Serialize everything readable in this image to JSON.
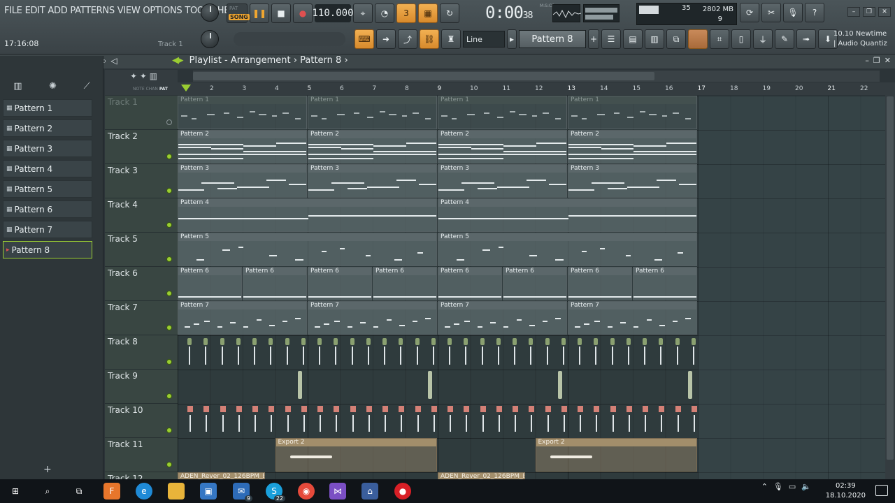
{
  "menu": [
    "FILE",
    "EDIT",
    "ADD",
    "PATTERNS",
    "VIEW",
    "OPTIONS",
    "TOOLS",
    "HELP"
  ],
  "hint": {
    "time": "17:16:08",
    "track": "Track 1"
  },
  "transport": {
    "pat": "PAT",
    "song": "SONG",
    "tempo": "110.000",
    "time": "0:00",
    "time_small": "38",
    "msc": "M:S:CS"
  },
  "cpu": {
    "v1": "35",
    "mem": "2802 MB",
    "poly": "9"
  },
  "toolbar2": {
    "snap": "Line",
    "pattern": "Pattern 8",
    "news_line1": "10.10  Newtime",
    "news_line2": "| Audio Quantiz"
  },
  "playlist": {
    "title": "Playlist - Arrangement",
    "pattern": "Pattern 8",
    "mini_labels": [
      "NOTE",
      "CHAN",
      "PAT"
    ]
  },
  "ruler": [
    "2",
    "3",
    "4",
    "5",
    "6",
    "7",
    "8",
    "9",
    "10",
    "11",
    "12",
    "13",
    "14",
    "15",
    "16",
    "17",
    "18",
    "19",
    "20",
    "21",
    "22"
  ],
  "patterns": [
    "Pattern 1",
    "Pattern 2",
    "Pattern 3",
    "Pattern 4",
    "Pattern 5",
    "Pattern 6",
    "Pattern 7",
    "Pattern 8"
  ],
  "selected_pattern": "Pattern 8",
  "tracks": [
    "Track 1",
    "Track 2",
    "Track 3",
    "Track 4",
    "Track 5",
    "Track 6",
    "Track 7",
    "Track 8",
    "Track 9",
    "Track 10",
    "Track 11",
    "Track 12"
  ],
  "clips": {
    "p1": "Pattern 1",
    "p2": "Pattern 2",
    "p3": "Pattern 3",
    "p4": "Pattern 4",
    "p5": "Pattern 5",
    "p6": "Pattern 6",
    "p7": "Pattern 7",
    "export": "Export 2",
    "aden": "ADEN_Rever_02_126BPM_E"
  },
  "taskbar": {
    "time": "02:39",
    "date": "18.10.2020",
    "mail_badge": "9",
    "skype_badge": "22"
  },
  "colors": {
    "accent_green": "#9acd32",
    "accent_orange": "#f0a630",
    "grid": "#2f3b3d",
    "audio_clip": "#a28e6b"
  }
}
